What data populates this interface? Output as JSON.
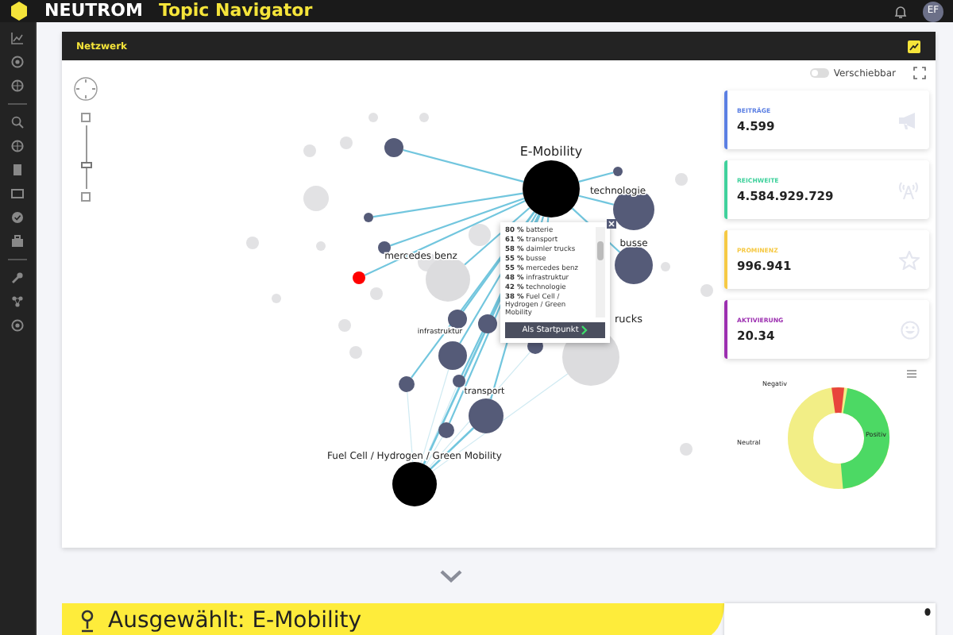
{
  "header": {
    "brand": "NEUTROM",
    "title": "Topic Navigator",
    "avatar": "EF"
  },
  "card": {
    "title": "Netzwerk",
    "toggle": {
      "label": "Verschiebbar",
      "on": false
    }
  },
  "zoom": {
    "level": 0.35
  },
  "graph": {
    "nodes": [
      {
        "label": "E-Mobility",
        "kind": "focus"
      },
      {
        "label": "technologie",
        "kind": "topic"
      },
      {
        "label": "busse",
        "kind": "topic"
      },
      {
        "label": "mercedes benz",
        "kind": "other"
      },
      {
        "label": "infrastruktur",
        "kind": "topic"
      },
      {
        "label": "transport",
        "kind": "topic"
      },
      {
        "label": "Fuel Cell / Hydrogen / Green Mobility",
        "kind": "focus"
      },
      {
        "label": "rucks",
        "kind": "other"
      }
    ],
    "tooltip": {
      "items": [
        {
          "percent": "80 %",
          "topic": "batterie"
        },
        {
          "percent": "61 %",
          "topic": "transport"
        },
        {
          "percent": "58 %",
          "topic": "daimler trucks"
        },
        {
          "percent": "55 %",
          "topic": "busse"
        },
        {
          "percent": "55 %",
          "topic": "mercedes benz"
        },
        {
          "percent": "48 %",
          "topic": "infrastruktur"
        },
        {
          "percent": "42 %",
          "topic": "technologie"
        },
        {
          "percent": "38 %",
          "topic": "Fuel Cell / Hydrogen / Green Mobility"
        }
      ],
      "button": "Als Startpunkt"
    }
  },
  "stats": [
    {
      "label": "BEITRÄGE",
      "value": "4.599",
      "color": "#5b7fe3"
    },
    {
      "label": "REICHWEITE",
      "value": "4.584.929.729",
      "color": "#3fd19c"
    },
    {
      "label": "PROMINENZ",
      "value": "996.941",
      "color": "#f6c944"
    },
    {
      "label": "AKTIVIERUNG",
      "value": "20.34",
      "color": "#9c2fb0"
    }
  ],
  "sentiment": {
    "labels": [
      {
        "label": "Negativ"
      },
      {
        "label": "Positiv"
      },
      {
        "label": "Neutral"
      }
    ]
  },
  "selection": {
    "label": "Ausgewählt: E-Mobility"
  }
}
